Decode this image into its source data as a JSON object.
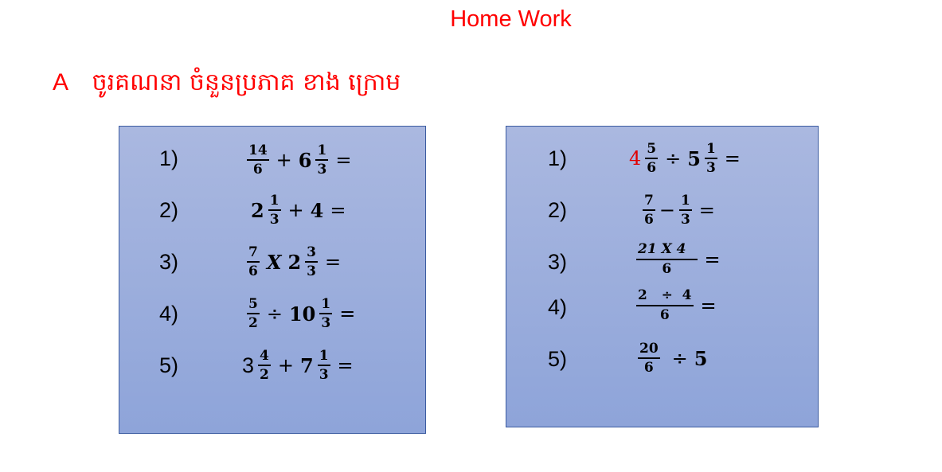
{
  "title": "Home Work",
  "section": {
    "letter": "A",
    "instruction": "ចូរគណនា ចំនួនប្រភាគ ខាង ក្រោម"
  },
  "left": {
    "items": [
      {
        "num": "1)",
        "f1n": "14",
        "f1d": "6",
        "op1": "+",
        "w1": "6",
        "f2n": "1",
        "f2d": "3",
        "eq": "="
      },
      {
        "num": "2)",
        "w1": "2",
        "f1n": "1",
        "f1d": "3",
        "op1": "+",
        "w2": "4",
        "eq": "="
      },
      {
        "num": "3)",
        "f1n": "7",
        "f1d": "6",
        "op1": "X",
        "w1": "2",
        "f2n": "3",
        "f2d": "3",
        "eq": "="
      },
      {
        "num": "4)",
        "f1n": "5",
        "f1d": "2",
        "op1": "÷",
        "w1": "10",
        "f2n": "1",
        "f2d": "3",
        "eq": "="
      },
      {
        "num": "5)",
        "w1": "3",
        "f1n": "4",
        "f1d": "2",
        "op1": "+",
        "w2": "7",
        "f2n": "1",
        "f2d": "3",
        "eq": "="
      }
    ]
  },
  "right": {
    "items": [
      {
        "num": "1)",
        "w1": "4",
        "f1n": "5",
        "f1d": "6",
        "op1": "÷",
        "w2": "5",
        "f2n": "1",
        "f2d": "3",
        "eq": "="
      },
      {
        "num": "2)",
        "f1n": "7",
        "f1d": "6",
        "op1": "−",
        "f2n": "1",
        "f2d": "3",
        "eq": "="
      },
      {
        "num": "3)",
        "f1n": "21 X 4",
        "f1d": "6",
        "eq": "="
      },
      {
        "num": "4)",
        "f1n": "2   ÷  4",
        "f1d": "6",
        "eq": "="
      },
      {
        "num": "5)",
        "f1n": "20",
        "f1d": "6",
        "op1": "÷",
        "w1": "5"
      }
    ]
  },
  "colors": {
    "title": "#ff0000",
    "box_top": "#aab8e0",
    "box_bottom": "#8ea4d9",
    "box_border": "#3b5ba0",
    "highlight": "#e00000"
  }
}
